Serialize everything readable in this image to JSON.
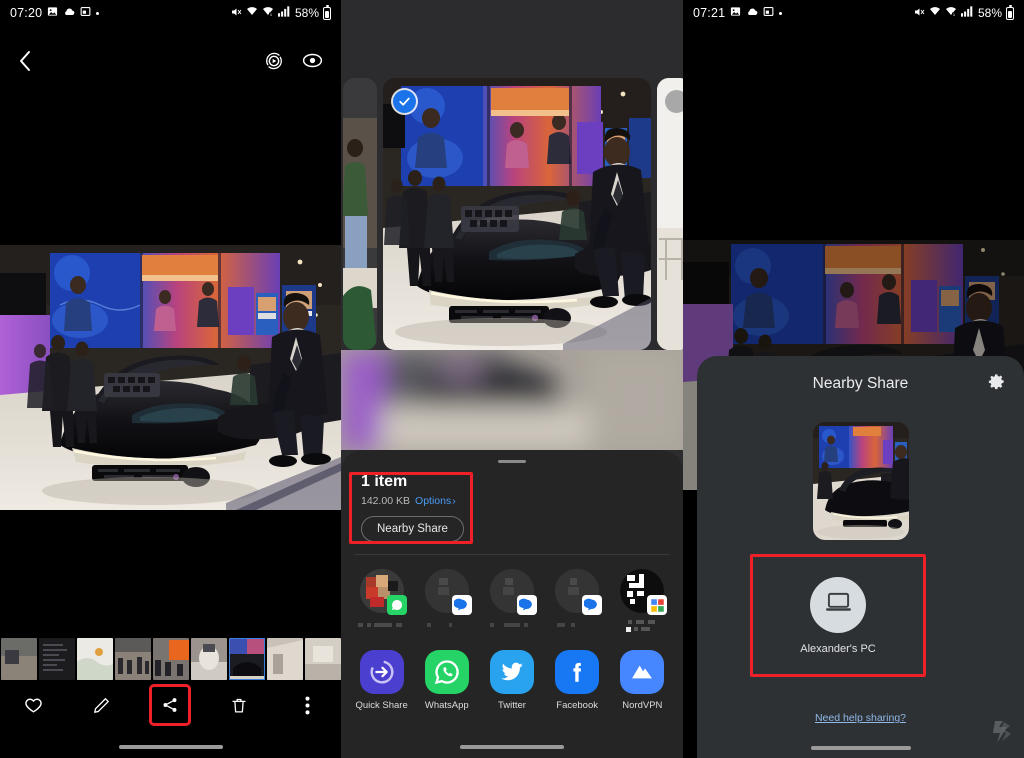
{
  "panels": {
    "viewer": {
      "status": {
        "time": "07:20",
        "battery": "58%",
        "icons": [
          "image-icon",
          "cloud-icon",
          "screenshot-icon",
          "dot-icon",
          "mute-icon",
          "wifi-icon",
          "call-wifi-icon",
          "signal-icon",
          "battery-icon"
        ]
      },
      "back_label": "Back",
      "topbar_icons": [
        "motion-photo-icon",
        "bixby-vision-icon"
      ],
      "toolbar": [
        {
          "name": "favorite",
          "label": "Favorite",
          "icon": "heart-icon",
          "highlighted": false
        },
        {
          "name": "edit",
          "label": "Edit",
          "icon": "pencil-icon",
          "highlighted": false
        },
        {
          "name": "share",
          "label": "Share",
          "icon": "share-icon",
          "highlighted": true
        },
        {
          "name": "delete",
          "label": "Delete",
          "icon": "trash-icon",
          "highlighted": false
        },
        {
          "name": "more",
          "label": "More options",
          "icon": "more-vertical-icon",
          "highlighted": false
        }
      ],
      "filmstrip_count": 12,
      "filmstrip_selected_index": 6
    },
    "share_sheet": {
      "status": {
        "time": "07:20",
        "battery": "58%"
      },
      "selection": {
        "checked": true,
        "unchecked_peer": true
      },
      "item_count": "1 item",
      "file_size": "142.00 KB",
      "options_label": "Options",
      "options_chevron": "›",
      "nearby_share_button": "Nearby Share",
      "contacts": [
        {
          "name": "contact-1",
          "badge": "whatsapp-badge",
          "badge_color": "#25d366"
        },
        {
          "name": "contact-2",
          "badge": "messages-badge",
          "badge_color": "#1a73e8"
        },
        {
          "name": "contact-3",
          "badge": "messages-badge",
          "badge_color": "#1a73e8"
        },
        {
          "name": "contact-4",
          "badge": "messages-badge",
          "badge_color": "#1a73e8"
        },
        {
          "name": "contact-5",
          "badge": "google-badge",
          "badge_color": "#ffffff"
        }
      ],
      "apps": [
        {
          "label": "Quick Share",
          "icon": "quick-share-icon",
          "color": "#4b3fcf"
        },
        {
          "label": "WhatsApp",
          "icon": "whatsapp-icon",
          "color": "#25d366"
        },
        {
          "label": "Twitter",
          "icon": "twitter-icon",
          "color": "#2aa3ef"
        },
        {
          "label": "Facebook",
          "icon": "facebook-icon",
          "color": "#1877f2"
        },
        {
          "label": "NordVPN",
          "icon": "nordvpn-icon",
          "color": "#4687ff"
        }
      ]
    },
    "nearby_share": {
      "status": {
        "time": "07:21",
        "battery": "58%"
      },
      "title": "Nearby Share",
      "settings_icon": "gear-icon",
      "device": {
        "name": "Alexander's PC",
        "icon": "laptop-icon",
        "highlighted": true
      },
      "help_link": "Need help sharing?",
      "watermark": "brand-logo"
    }
  },
  "colors": {
    "highlight": "#ef2027",
    "link": "#4a9bf5",
    "sheet_bg": "#252525",
    "nearby_bg": "#2e3134",
    "accent_blue": "#1a73e8"
  }
}
